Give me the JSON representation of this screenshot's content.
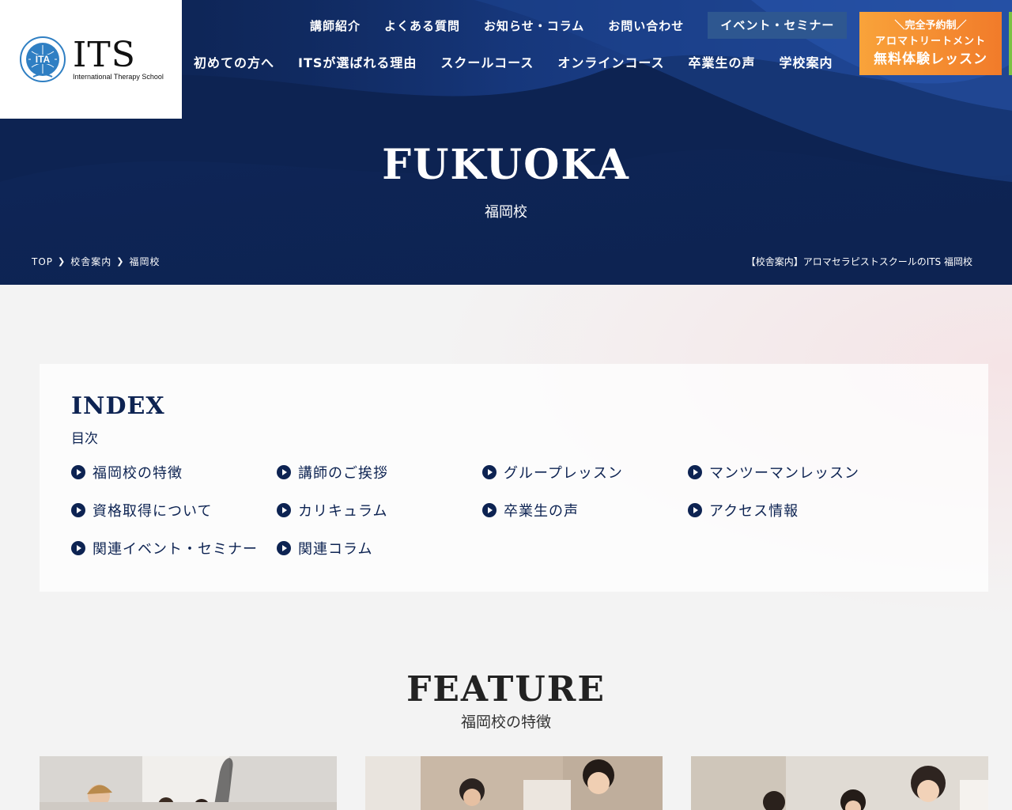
{
  "brand": {
    "logo_text": "ITS",
    "logo_subtitle": "International Therapy School",
    "emblem_text": "ITA"
  },
  "nav_top": [
    {
      "label": "講師紹介"
    },
    {
      "label": "よくある質問"
    },
    {
      "label": "お知らせ・コラム"
    },
    {
      "label": "お問い合わせ"
    }
  ],
  "event_button": "イベント・セミナー",
  "nav_main": [
    {
      "label": "初めての方へ"
    },
    {
      "label": "ITSが選ばれる理由"
    },
    {
      "label": "スクールコース"
    },
    {
      "label": "オンラインコース"
    },
    {
      "label": "卒業生の声"
    },
    {
      "label": "学校案内"
    }
  ],
  "cta": {
    "line1": "＼完全予約制／",
    "line2": "アロマトリートメント",
    "line3": "無料体験レッスン"
  },
  "hero": {
    "title": "FUKUOKA",
    "subtitle": "福岡校",
    "caption": "【校舎案内】アロマセラピストスクールのITS 福岡校"
  },
  "breadcrumb": [
    "TOP",
    "校舎案内",
    "福岡校"
  ],
  "index": {
    "title": "INDEX",
    "subtitle": "目次",
    "items": [
      "福岡校の特徴",
      "講師のご挨拶",
      "グループレッスン",
      "マンツーマンレッスン",
      "資格取得について",
      "カリキュラム",
      "卒業生の声",
      "アクセス情報",
      "関連イベント・セミナー",
      "関連コラム"
    ]
  },
  "feature": {
    "title": "FEATURE",
    "subtitle": "福岡校の特徴"
  },
  "colors": {
    "navy": "#0d2352",
    "event_button": "#2e5790",
    "cta_orange": "#f38a2e",
    "accent_green": "#7cc242"
  }
}
